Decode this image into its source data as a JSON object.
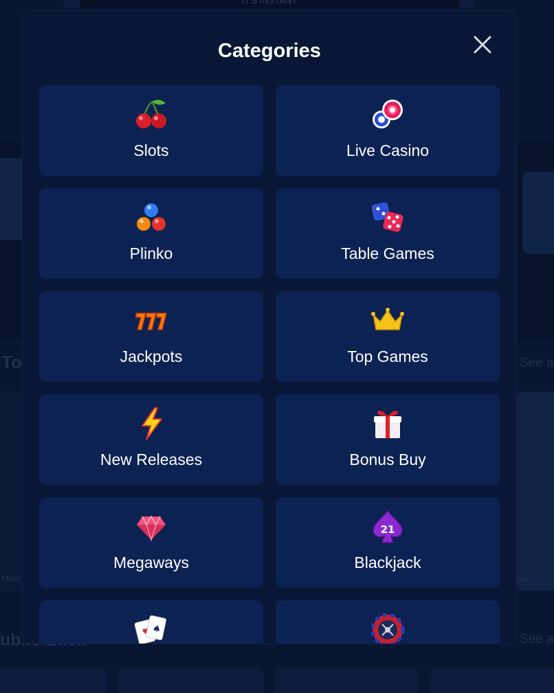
{
  "background": {
    "banner_text": "IT'S INSTANT",
    "left_heading": "To",
    "right_link_1": "See a",
    "bottom_heading": "ub.io Luck",
    "right_link_2": "See a",
    "left_caption": "Masc",
    "right_caption": "ina"
  },
  "modal": {
    "title": "Categories",
    "close_icon": "close-icon"
  },
  "categories": [
    {
      "label": "Slots",
      "icon": "cherries-icon"
    },
    {
      "label": "Live Casino",
      "icon": "casino-chips-icon"
    },
    {
      "label": "Plinko",
      "icon": "plinko-balls-icon"
    },
    {
      "label": "Table Games",
      "icon": "dice-icon"
    },
    {
      "label": "Jackpots",
      "icon": "lucky-777-icon"
    },
    {
      "label": "Top Games",
      "icon": "crown-icon"
    },
    {
      "label": "New Releases",
      "icon": "lightning-icon"
    },
    {
      "label": "Bonus Buy",
      "icon": "gift-box-icon"
    },
    {
      "label": "Megaways",
      "icon": "gem-icon"
    },
    {
      "label": "Blackjack",
      "icon": "spade-21-icon"
    },
    {
      "label": "",
      "icon": "playing-cards-icon"
    },
    {
      "label": "",
      "icon": "roulette-wheel-icon"
    }
  ],
  "colors": {
    "modal_bg": "#071735",
    "tile_bg": "#0b2252",
    "text": "#ffffff"
  }
}
